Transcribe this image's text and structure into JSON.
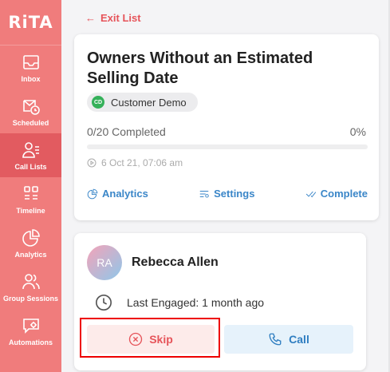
{
  "app": {
    "logo": "RiTA"
  },
  "sidebar": {
    "items": [
      {
        "label": "Inbox",
        "icon": "inbox-icon"
      },
      {
        "label": "Scheduled",
        "icon": "calendar-clock-icon"
      },
      {
        "label": "Call Lists",
        "icon": "call-list-icon",
        "active": true
      },
      {
        "label": "Timeline",
        "icon": "timeline-icon"
      },
      {
        "label": "Analytics",
        "icon": "pie-chart-icon"
      },
      {
        "label": "Group Sessions",
        "icon": "group-icon"
      },
      {
        "label": "Automations",
        "icon": "automation-icon"
      }
    ]
  },
  "header": {
    "exit_label": "Exit List"
  },
  "list_card": {
    "title": "Owners Without an Estimated Selling Date",
    "badge_initials": "CD",
    "badge_label": "Customer Demo",
    "progress_text": "0/20 Completed",
    "progress_percent": "0%",
    "progress_value": 0,
    "date": "6 Oct 21, 07:06 am",
    "actions": {
      "analytics": "Analytics",
      "settings": "Settings",
      "complete": "Complete"
    }
  },
  "contact_card": {
    "initials": "RA",
    "name": "Rebecca Allen",
    "last_engaged": "Last Engaged: 1 month ago",
    "skip_label": "Skip",
    "call_label": "Call"
  },
  "colors": {
    "sidebar": "#f07c7c",
    "sidebar_active": "#e25b60",
    "accent_red": "#e6545a",
    "accent_blue": "#3a86c8"
  }
}
